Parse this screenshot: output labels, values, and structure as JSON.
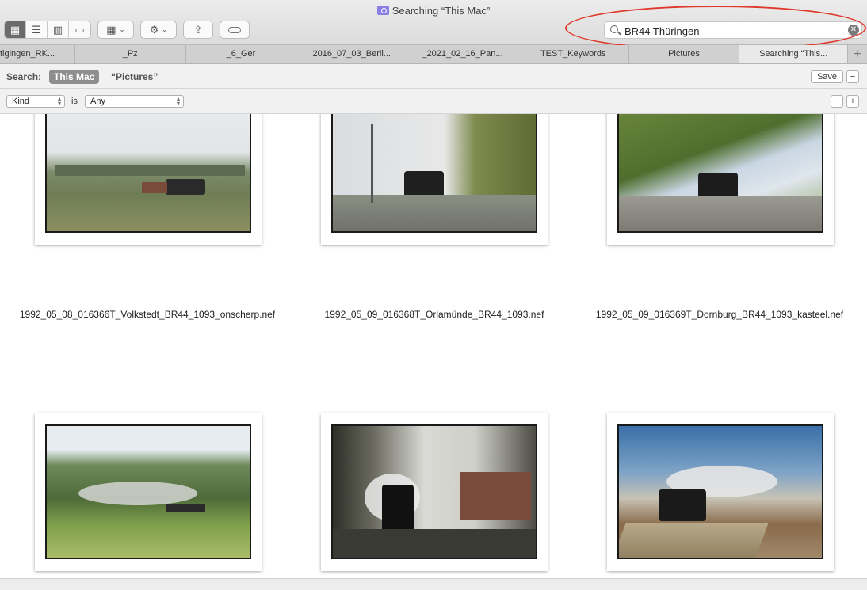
{
  "window": {
    "title": "Searching “This Mac”"
  },
  "toolbar": {
    "view_icons": [
      "grid-icon",
      "list-icon",
      "columns-icon",
      "gallery-icon"
    ],
    "group_icon": "group-grid-icon",
    "action_icon": "gear-icon",
    "share_icon": "share-icon",
    "tag_icon": "tag-icon"
  },
  "search": {
    "value": "BR44 Thüringen"
  },
  "tabs": [
    {
      "label": "tigingen_RK..."
    },
    {
      "label": "_Pz"
    },
    {
      "label": "_6_Ger"
    },
    {
      "label": "2016_07_03_Berli..."
    },
    {
      "label": "_2021_02_16_Pan..."
    },
    {
      "label": "TEST_Keywords"
    },
    {
      "label": "Pictures"
    },
    {
      "label": "Searching “This..."
    }
  ],
  "scope": {
    "label": "Search:",
    "this_mac": "This Mac",
    "pictures": "“Pictures”",
    "save": "Save"
  },
  "criteria": {
    "attribute": "Kind",
    "operator": "is",
    "value": "Any"
  },
  "files": [
    {
      "name": "1992_05_08_016366T_Volkstedt_BR44_1093_onscherp.nef"
    },
    {
      "name": "1992_05_09_016368T_Orlamünde_BR44_1093.nef"
    },
    {
      "name": "1992_05_09_016369T_Dornburg_BR44_1093_kasteel.nef"
    },
    {
      "name": ""
    },
    {
      "name": ""
    },
    {
      "name": ""
    }
  ]
}
